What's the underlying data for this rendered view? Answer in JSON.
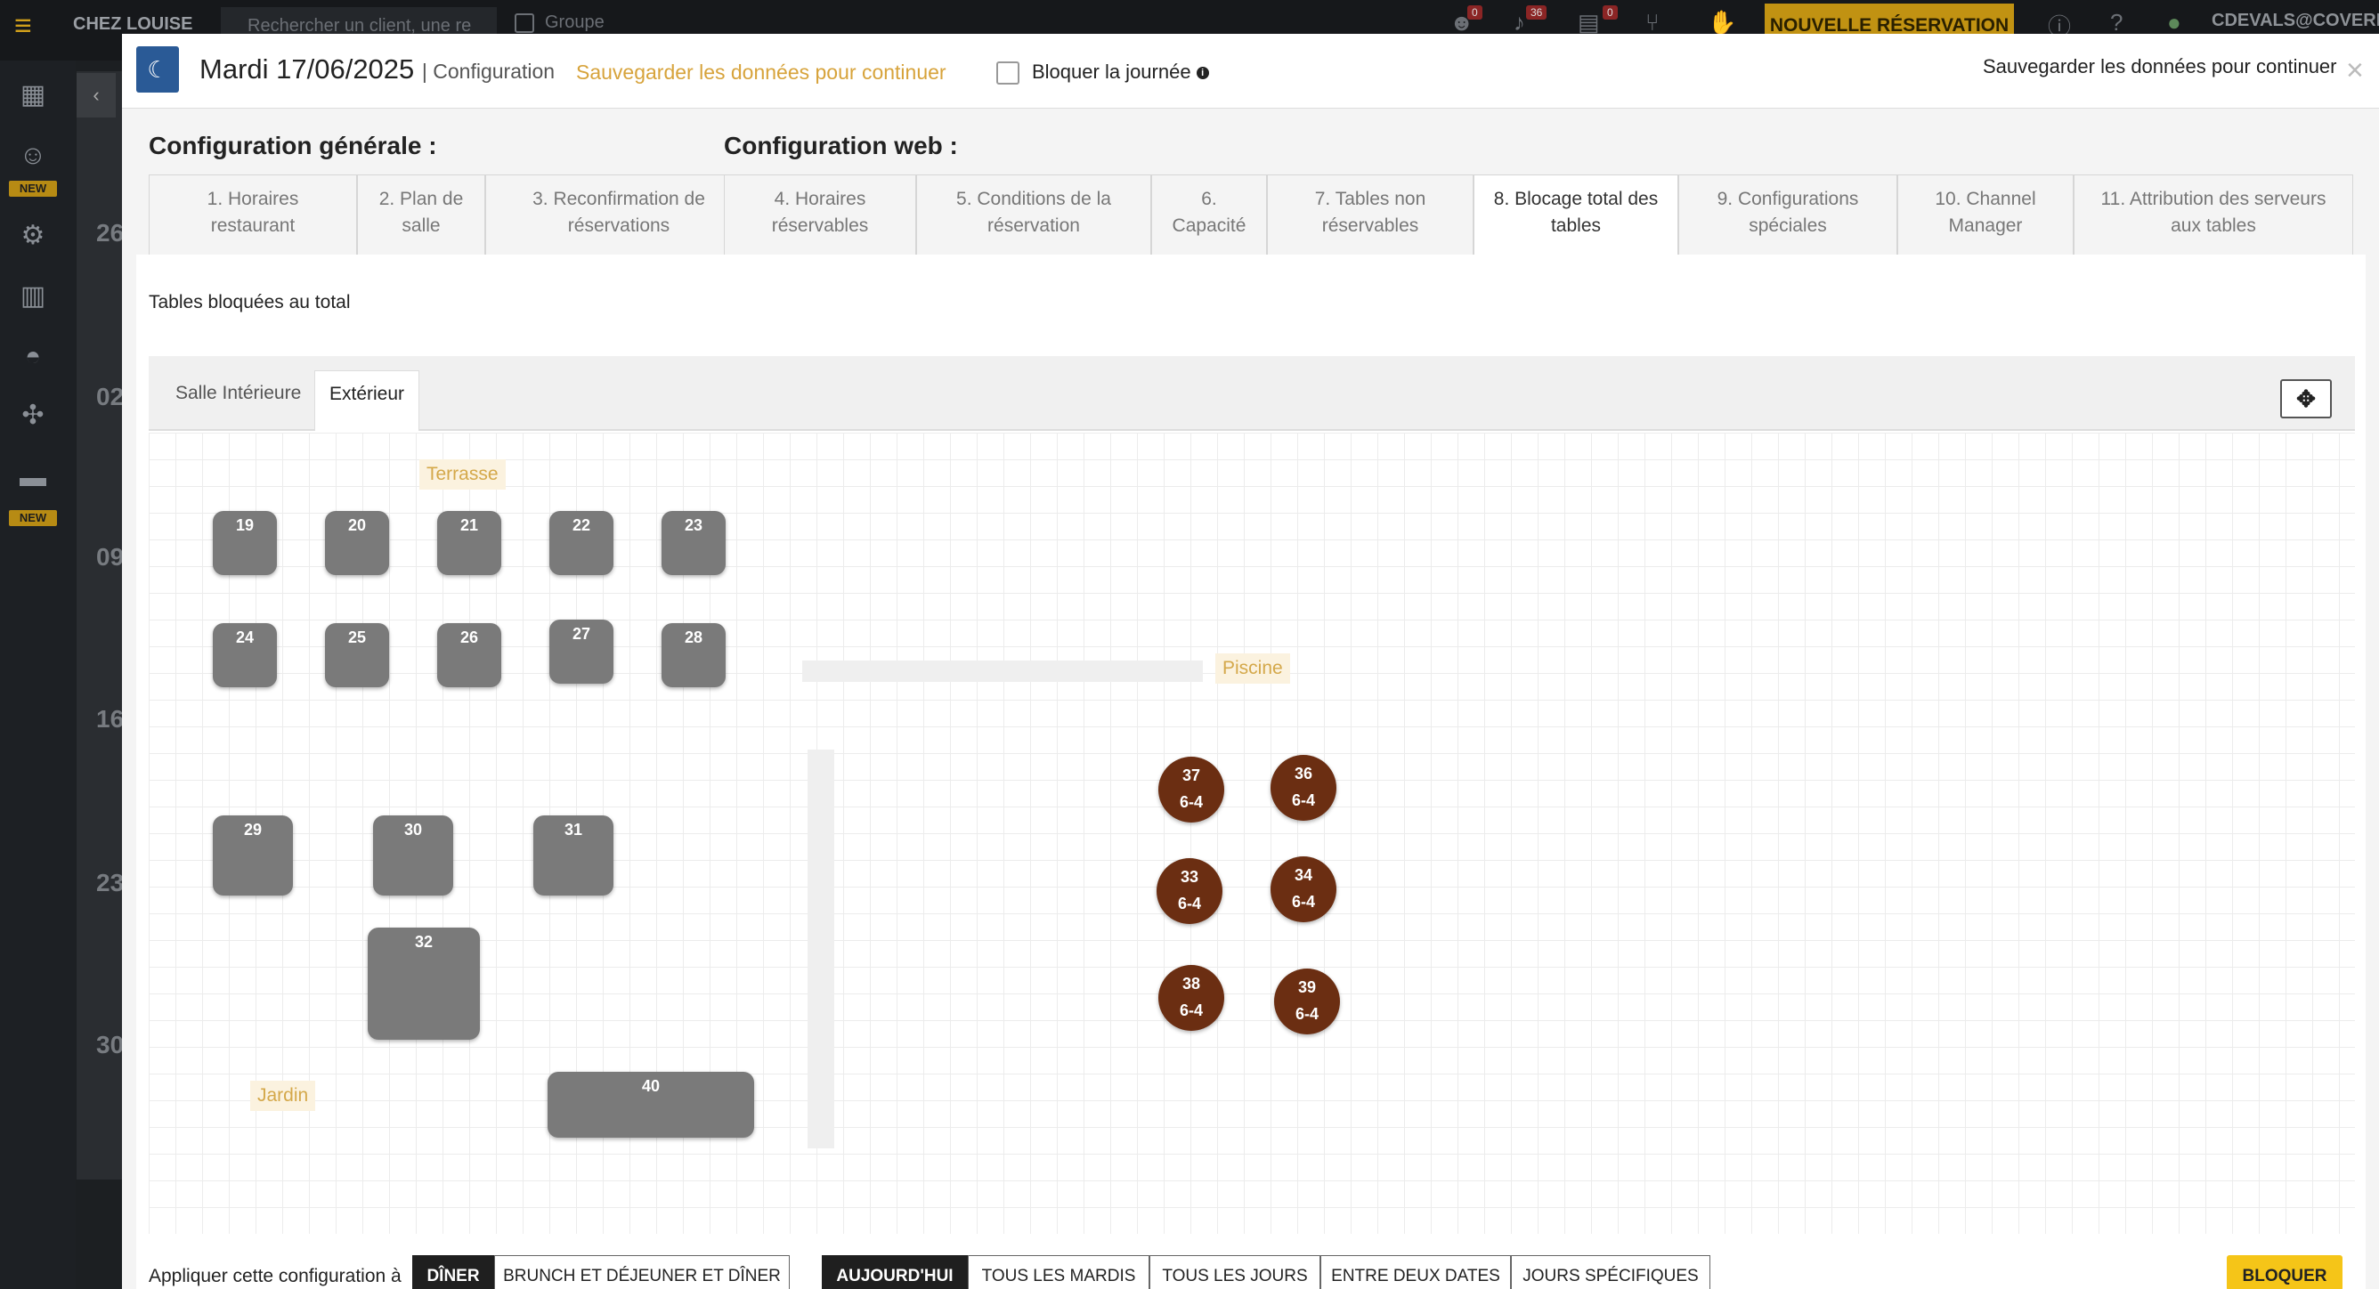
{
  "topbar": {
    "brand": "CHEZ LOUISE",
    "search_placeholder": "Rechercher un client, une re",
    "group_label": "Groupe",
    "new_reservation": "NOUVELLE RÉSERVATION",
    "user": "CDEVALS@COVERMA",
    "badges": [
      "0",
      "36",
      "0"
    ]
  },
  "sidebar": {
    "new_label": "NEW",
    "icons": [
      "calendar-icon",
      "guest-icon",
      "gear-icon",
      "chart-icon",
      "cloche-icon",
      "puzzle-icon",
      "ticket-icon"
    ]
  },
  "calendar_dates": [
    "26",
    "02",
    "09",
    "16",
    "23",
    "30"
  ],
  "modal": {
    "date": "Mardi 17/06/2025",
    "section": "| Configuration",
    "warning": "Sauvegarder les données pour continuer",
    "block_day": "Bloquer la journée",
    "save_prompt": "Sauvegarder les données pour continuer",
    "close": "×",
    "general_title": "Configuration générale :",
    "web_title": "Configuration web :",
    "tabs": [
      {
        "line1": "1. Horaires",
        "line2": "restaurant"
      },
      {
        "line1": "2. Plan de",
        "line2": "salle"
      },
      {
        "line1": "3. Reconfirmation de",
        "line2": "réservations"
      },
      {
        "line1": "4. Horaires",
        "line2": "réservables"
      },
      {
        "line1": "5. Conditions de la",
        "line2": "réservation"
      },
      {
        "line1": "6.",
        "line2": "Capacité"
      },
      {
        "line1": "7. Tables non",
        "line2": "réservables"
      },
      {
        "line1": "8. Blocage total des",
        "line2": "tables"
      },
      {
        "line1": "9. Configurations",
        "line2": "spéciales"
      },
      {
        "line1": "10. Channel",
        "line2": "Manager"
      },
      {
        "line1": "11. Attribution des serveurs",
        "line2": "aux tables"
      }
    ],
    "content_title": "Tables bloquées au total",
    "rooms": [
      "Salle Intérieure",
      "Extérieur"
    ],
    "add_icon": "move-icon",
    "zones": {
      "terrasse": "Terrasse",
      "piscine": "Piscine",
      "jardin": "Jardin"
    },
    "tables": [
      "19",
      "20",
      "21",
      "22",
      "23",
      "24",
      "25",
      "26",
      "27",
      "28",
      "29",
      "30",
      "31",
      "32",
      "40"
    ],
    "round_tables": [
      {
        "n": "37",
        "cap": "6-4"
      },
      {
        "n": "36",
        "cap": "6-4"
      },
      {
        "n": "33",
        "cap": "6-4"
      },
      {
        "n": "34",
        "cap": "6-4"
      },
      {
        "n": "38",
        "cap": "6-4"
      },
      {
        "n": "39",
        "cap": "6-4"
      }
    ],
    "apply_label": "Appliquer cette configuration à",
    "services": [
      "DÎNER",
      "BRUNCH ET DÉJEUNER ET DÎNER"
    ],
    "periods": [
      "AUJOURD'HUI",
      "TOUS LES MARDIS",
      "TOUS LES JOURS",
      "ENTRE DEUX DATES",
      "JOURS SPÉCIFIQUES"
    ],
    "block_button": "BLOQUER"
  }
}
